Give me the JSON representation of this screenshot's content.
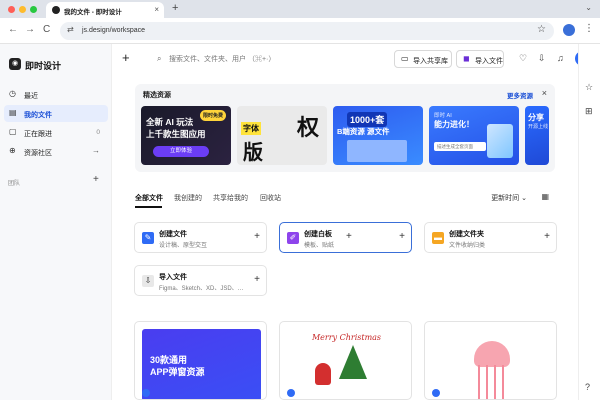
{
  "browser": {
    "tab_title": "我的文件 - 即时设计",
    "tab_close": "×",
    "new_tab": "+",
    "tab_dropdown": "⌄",
    "url": "js.design/workspace",
    "back": "←",
    "forward": "→",
    "reload": "C",
    "url_icon": "⇄",
    "star": "☆",
    "menu": "⋮"
  },
  "sidebar": {
    "logo_text": "即时设计",
    "logo_glyph": "◉",
    "items": [
      {
        "label": "最近",
        "icon": "◷",
        "count": "",
        "arrow": ""
      },
      {
        "label": "我的文件",
        "icon": "▤",
        "count": "",
        "arrow": ""
      },
      {
        "label": "正在跟进",
        "icon": "▢",
        "count": "0",
        "arrow": ""
      },
      {
        "label": "资源社区",
        "icon": "⊕",
        "count": "",
        "arrow": "→"
      }
    ],
    "team_label": "团队",
    "team_add": "+"
  },
  "topbar": {
    "plus": "+",
    "search_icon": "⌕",
    "search_placeholder": "搜索文件、文件夹、用户 （⌘+·）",
    "import_library": "导入共享库",
    "import_library_icon": "▭",
    "import_file": "导入文件",
    "import_file_icon": "◼",
    "icon_bulb": "♡",
    "icon_download": "⇩",
    "icon_bell": "♫"
  },
  "featured": {
    "title": "精选资源",
    "more": "更多资源",
    "close": "×",
    "banner1": {
      "line1": "全新 AI 玩法",
      "line2": "上千款生图应用",
      "badge": "限时免费",
      "cta": "立即体验"
    },
    "banner2": {
      "chars": [
        "字体",
        "版",
        "权"
      ]
    },
    "banner3": {
      "line1": "1000+套",
      "line2": "B端资源 源文件"
    },
    "banner4": {
      "line1": "即时 AI",
      "line2": "能力进化！",
      "input": "描述生成全套页面"
    },
    "banner5": {
      "line1": "分享",
      "line2": "开源上线"
    }
  },
  "file_tabs": {
    "tabs": [
      "全部文件",
      "我创建的",
      "共享给我的",
      "回收站"
    ],
    "sort": "更新时间 ⌄",
    "grid_icon": "▦"
  },
  "cards": [
    {
      "title": "创建文件",
      "sub": "设计稿、原型交互",
      "icon": "✎",
      "color": "#2f6bf5",
      "plus": "+"
    },
    {
      "title": "创建白板",
      "sub": "模板、贴纸",
      "icon": "✐",
      "color": "#8e44ec",
      "plus": "+",
      "plus_mid": "+"
    },
    {
      "title": "创建文件夹",
      "sub": "文件收纳归类",
      "icon": "▬",
      "color": "#f5a623",
      "plus": "+"
    },
    {
      "title": "导入文件",
      "sub": "Figma、Sketch、XD、JSD、…",
      "icon": "⇩",
      "color": "#444444",
      "plus": "+"
    }
  ],
  "thumbnails": [
    {
      "line1": "30款通用",
      "line2": "APP弹窗资源"
    },
    {
      "line1": "Merry Christmas"
    },
    {
      "line1": ""
    }
  ],
  "rightbar": {
    "icons": [
      "☆",
      "⊞",
      "?"
    ]
  }
}
